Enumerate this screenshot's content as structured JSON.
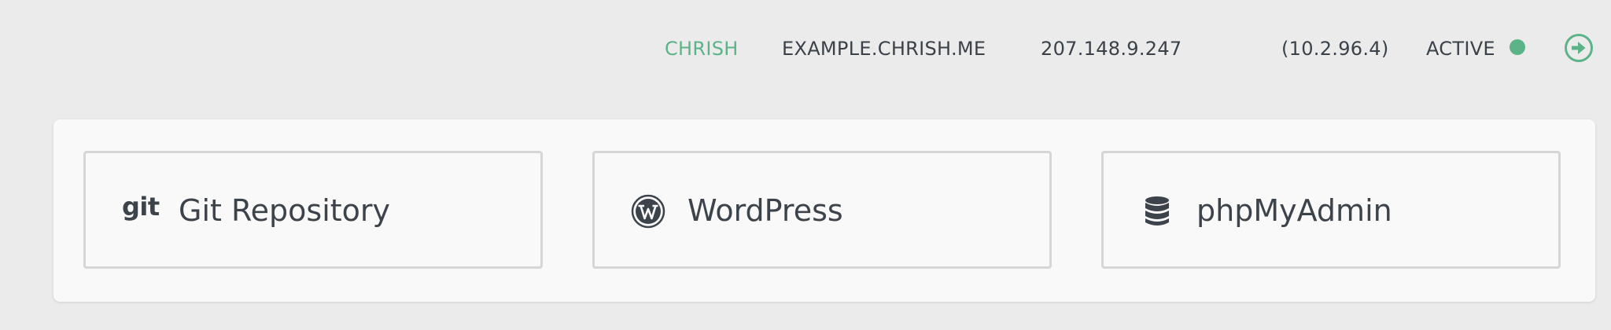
{
  "header": {
    "username": "CHRISH",
    "domain": "EXAMPLE.CHRISH.ME",
    "public_ip": "207.148.9.247",
    "private_ip": "(10.2.96.4)",
    "status": "ACTIVE",
    "status_color": "#5cb387",
    "action_icon": "arrow-right-circle-icon"
  },
  "apps": [
    {
      "label": "Git Repository",
      "icon": "git-icon",
      "icon_text": "git"
    },
    {
      "label": "WordPress",
      "icon": "wordpress-icon"
    },
    {
      "label": "phpMyAdmin",
      "icon": "database-icon"
    }
  ],
  "colors": {
    "accent": "#5cb387",
    "text": "#3d434b",
    "background": "#ebebeb",
    "panel": "#f9f9f9",
    "card_border": "#d6d6d6"
  }
}
